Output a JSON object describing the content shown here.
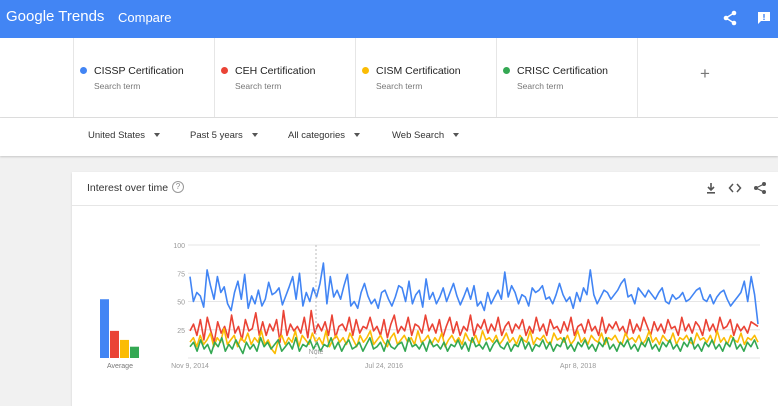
{
  "header": {
    "logo_google": "Google",
    "logo_trends": "Trends",
    "title": "Compare",
    "icons": [
      "share-icon",
      "feedback-icon"
    ]
  },
  "terms": [
    {
      "name": "CISSP Certification",
      "sub": "Search term",
      "color": "#4285f4"
    },
    {
      "name": "CEH Certification",
      "sub": "Search term",
      "color": "#ea4335"
    },
    {
      "name": "CISM Certification",
      "sub": "Search term",
      "color": "#fbbc04"
    },
    {
      "name": "CRISC Certification",
      "sub": "Search term",
      "color": "#34a853"
    }
  ],
  "add_term": "+",
  "filters": [
    {
      "label": "United States"
    },
    {
      "label": "Past 5 years"
    },
    {
      "label": "All categories"
    },
    {
      "label": "Web Search"
    }
  ],
  "card": {
    "title": "Interest over time",
    "help": "?",
    "icons": [
      "download-icon",
      "embed-icon",
      "share-icon"
    ]
  },
  "colors": {
    "brand": "#4285f4",
    "grid": "#e6e6e6"
  },
  "chart_data": {
    "type": "line",
    "ylim": [
      0,
      100
    ],
    "y_ticks": [
      "100",
      "75",
      "50",
      "25"
    ],
    "x_tick_labels": [
      "Nov 9, 2014",
      "Jul 24, 2016",
      "Apr 8, 2018"
    ],
    "annotation": "Note",
    "average_label": "Average",
    "averages": [
      52,
      24,
      16,
      10
    ],
    "series": [
      {
        "name": "CISSP Certification",
        "values": [
          72,
          50,
          58,
          55,
          45,
          78,
          64,
          52,
          72,
          58,
          63,
          48,
          42,
          58,
          68,
          52,
          74,
          44,
          55,
          48,
          60,
          46,
          52,
          67,
          56,
          58,
          62,
          47,
          55,
          63,
          72,
          52,
          75,
          46,
          58,
          50,
          62,
          54,
          66,
          84,
          48,
          72,
          54,
          60,
          52,
          64,
          74,
          46,
          50,
          44,
          58,
          66,
          55,
          48,
          52,
          44,
          58,
          60,
          52,
          46,
          54,
          64,
          62,
          50,
          68,
          48,
          56,
          60,
          45,
          70,
          52,
          58,
          48,
          54,
          62,
          50,
          58,
          66,
          55,
          47,
          54,
          62,
          52,
          64,
          46,
          50,
          42,
          58,
          48,
          54,
          60,
          52,
          76,
          54,
          64,
          58,
          48,
          56,
          54,
          46,
          62,
          58,
          60,
          64,
          52,
          54,
          48,
          56,
          66,
          56,
          50,
          54,
          44,
          58,
          50,
          62,
          56,
          78,
          56,
          48,
          54,
          60,
          58,
          52,
          56,
          60,
          66,
          70,
          54,
          56,
          48,
          62,
          58,
          54,
          60,
          56,
          52,
          58,
          62,
          50,
          48,
          56,
          52,
          54,
          58,
          50,
          52,
          56,
          60,
          62,
          52,
          50,
          56,
          48,
          54,
          58,
          60,
          52,
          46,
          50,
          54,
          58,
          68,
          50,
          72,
          56,
          30
        ]
      },
      {
        "name": "CEH Certification",
        "values": [
          24,
          30,
          20,
          34,
          16,
          36,
          24,
          14,
          32,
          22,
          28,
          18,
          38,
          22,
          28,
          16,
          34,
          24,
          26,
          40,
          20,
          32,
          20,
          30,
          24,
          34,
          14,
          42,
          20,
          30,
          24,
          28,
          22,
          36,
          18,
          42,
          22,
          30,
          24,
          32,
          20,
          38,
          18,
          28,
          30,
          24,
          36,
          20,
          34,
          22,
          28,
          26,
          36,
          24,
          28,
          20,
          34,
          18,
          30,
          38,
          22,
          28,
          24,
          36,
          20,
          30,
          28,
          22,
          38,
          24,
          30,
          22,
          34,
          18,
          28,
          36,
          22,
          32,
          20,
          28,
          24,
          38,
          20,
          30,
          26,
          34,
          22,
          30,
          24,
          36,
          20,
          28,
          32,
          22,
          30,
          26,
          34,
          20,
          28,
          22,
          36,
          24,
          30,
          20,
          34,
          26,
          28,
          22,
          32,
          24,
          36,
          20,
          28,
          30,
          22,
          34,
          24,
          28,
          20,
          36,
          22,
          30,
          26,
          32,
          24,
          28,
          20,
          34,
          22,
          30,
          24,
          36,
          28,
          20,
          32,
          24,
          30,
          22,
          34,
          26,
          28,
          20,
          36,
          24,
          30,
          22,
          32,
          28,
          20,
          34,
          24,
          30,
          22,
          36,
          26,
          28,
          34,
          20,
          30,
          24,
          28,
          22,
          32,
          30,
          28
        ]
      },
      {
        "name": "CISM Certification",
        "values": [
          14,
          18,
          10,
          20,
          12,
          16,
          22,
          10,
          18,
          14,
          26,
          12,
          16,
          20,
          10,
          18,
          14,
          22,
          12,
          18,
          14,
          24,
          12,
          16,
          8,
          4,
          16,
          20,
          12,
          18,
          14,
          24,
          10,
          20,
          16,
          12,
          22,
          14,
          18,
          12,
          24,
          10,
          16,
          20,
          14,
          18,
          12,
          22,
          16,
          10,
          20,
          14,
          18,
          24,
          12,
          16,
          20,
          14,
          10,
          18,
          22,
          12,
          16,
          20,
          14,
          18,
          12,
          24,
          14,
          16,
          20,
          12,
          18,
          14,
          22,
          10,
          16,
          20,
          14,
          18,
          12,
          22,
          16,
          14,
          20,
          12,
          24,
          16,
          18,
          14,
          20,
          12,
          16,
          22,
          14,
          18,
          12,
          20,
          16,
          14,
          24,
          12,
          18,
          16,
          20,
          14,
          12,
          22,
          16,
          18,
          14,
          20,
          12,
          16,
          24,
          14,
          18,
          12,
          20,
          16,
          14,
          22,
          12,
          18,
          16,
          20,
          14,
          12,
          22,
          16,
          18,
          14,
          20,
          12,
          16,
          24,
          14,
          18,
          12,
          20,
          16,
          14,
          22,
          12,
          18,
          16,
          20,
          14,
          12,
          22,
          16,
          18,
          14,
          20,
          12,
          24,
          14,
          18,
          12,
          20,
          16,
          14,
          22,
          12,
          18,
          16,
          20,
          14
        ]
      },
      {
        "name": "CRISC Certification",
        "values": [
          10,
          14,
          6,
          16,
          8,
          12,
          4,
          14,
          10,
          18,
          6,
          12,
          8,
          16,
          10,
          4,
          14,
          8,
          12,
          6,
          18,
          10,
          14,
          8,
          12,
          16,
          6,
          10,
          14,
          8,
          18,
          6,
          12,
          10,
          16,
          8,
          14,
          6,
          12,
          10,
          18,
          8,
          14,
          6,
          12,
          16,
          8,
          10,
          14,
          6,
          12,
          18,
          8,
          10,
          14,
          6,
          16,
          10,
          8,
          12,
          14,
          6,
          18,
          10,
          12,
          8,
          14,
          6,
          16,
          10,
          12,
          8,
          14,
          6,
          12,
          10,
          16,
          8,
          14,
          6,
          18,
          10,
          12,
          8,
          14,
          6,
          12,
          16,
          10,
          8,
          14,
          6,
          12,
          10,
          18,
          8,
          14,
          6,
          12,
          10,
          16,
          8,
          14,
          6,
          12,
          10,
          18,
          8,
          12,
          6,
          14,
          10,
          16,
          8,
          12,
          6,
          14,
          10,
          18,
          8,
          12,
          6,
          14,
          10,
          16,
          8,
          12,
          6,
          14,
          10,
          18,
          8,
          12,
          6,
          14,
          10,
          16,
          8,
          12,
          6,
          14,
          10,
          18,
          8,
          12,
          6,
          14,
          10,
          16,
          8,
          12,
          6,
          14,
          10,
          18,
          8,
          12,
          6,
          14,
          10,
          16,
          8
        ]
      }
    ]
  }
}
